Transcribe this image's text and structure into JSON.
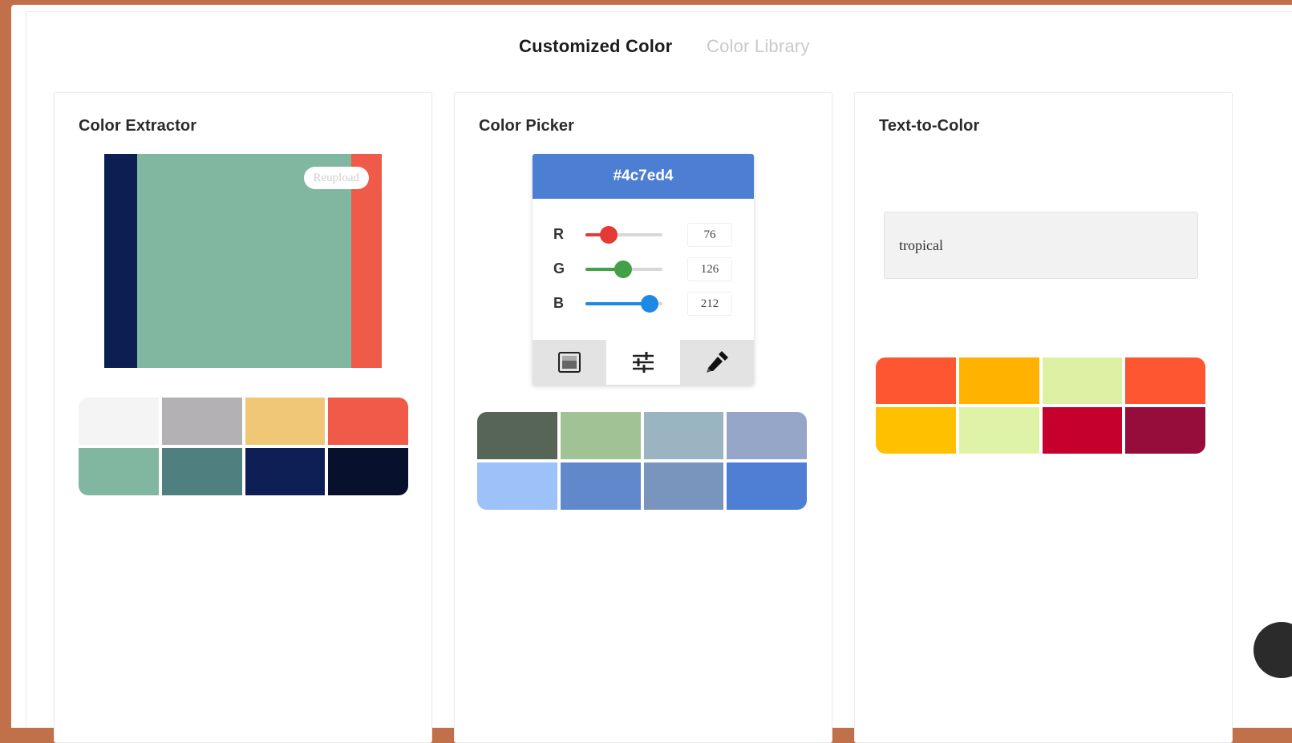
{
  "tabs": [
    {
      "label": "Customized Color",
      "active": true
    },
    {
      "label": "Color Library",
      "active": false
    }
  ],
  "extractor": {
    "title": "Color Extractor",
    "reupload_label": "Reupload",
    "image_bands": [
      "#0d1f52",
      "#81b7a0",
      "#ef5a49"
    ],
    "palette": [
      "#f4f4f4",
      "#b3b1b3",
      "#efc777",
      "#ef5a49",
      "#81b7a0",
      "#4f7f7e",
      "#0e1f55",
      "#07112e"
    ]
  },
  "picker": {
    "title": "Color Picker",
    "hex": "#4c7ed4",
    "channels": [
      {
        "label": "R",
        "value": "76",
        "fraction": 0.3,
        "color": "#e53935"
      },
      {
        "label": "G",
        "value": "126",
        "fraction": 0.49,
        "color": "#43a047"
      },
      {
        "label": "B",
        "value": "212",
        "fraction": 0.83,
        "color": "#1e88e5"
      }
    ],
    "modes": [
      "gradient-icon",
      "sliders-icon",
      "eyedropper-icon"
    ],
    "palette": [
      "#566555",
      "#a1c294",
      "#9ab5c1",
      "#95a6c8",
      "#9dc2fa",
      "#6188cb",
      "#7a95bd",
      "#4e7fd5"
    ]
  },
  "text_to_color": {
    "title": "Text-to-Color",
    "input_value": "tropical",
    "palette": [
      "#fd5631",
      "#ffb300",
      "#ddf0a3",
      "#fd5631",
      "#ffc000",
      "#dff3a8",
      "#c6002d",
      "#960c3a"
    ]
  }
}
